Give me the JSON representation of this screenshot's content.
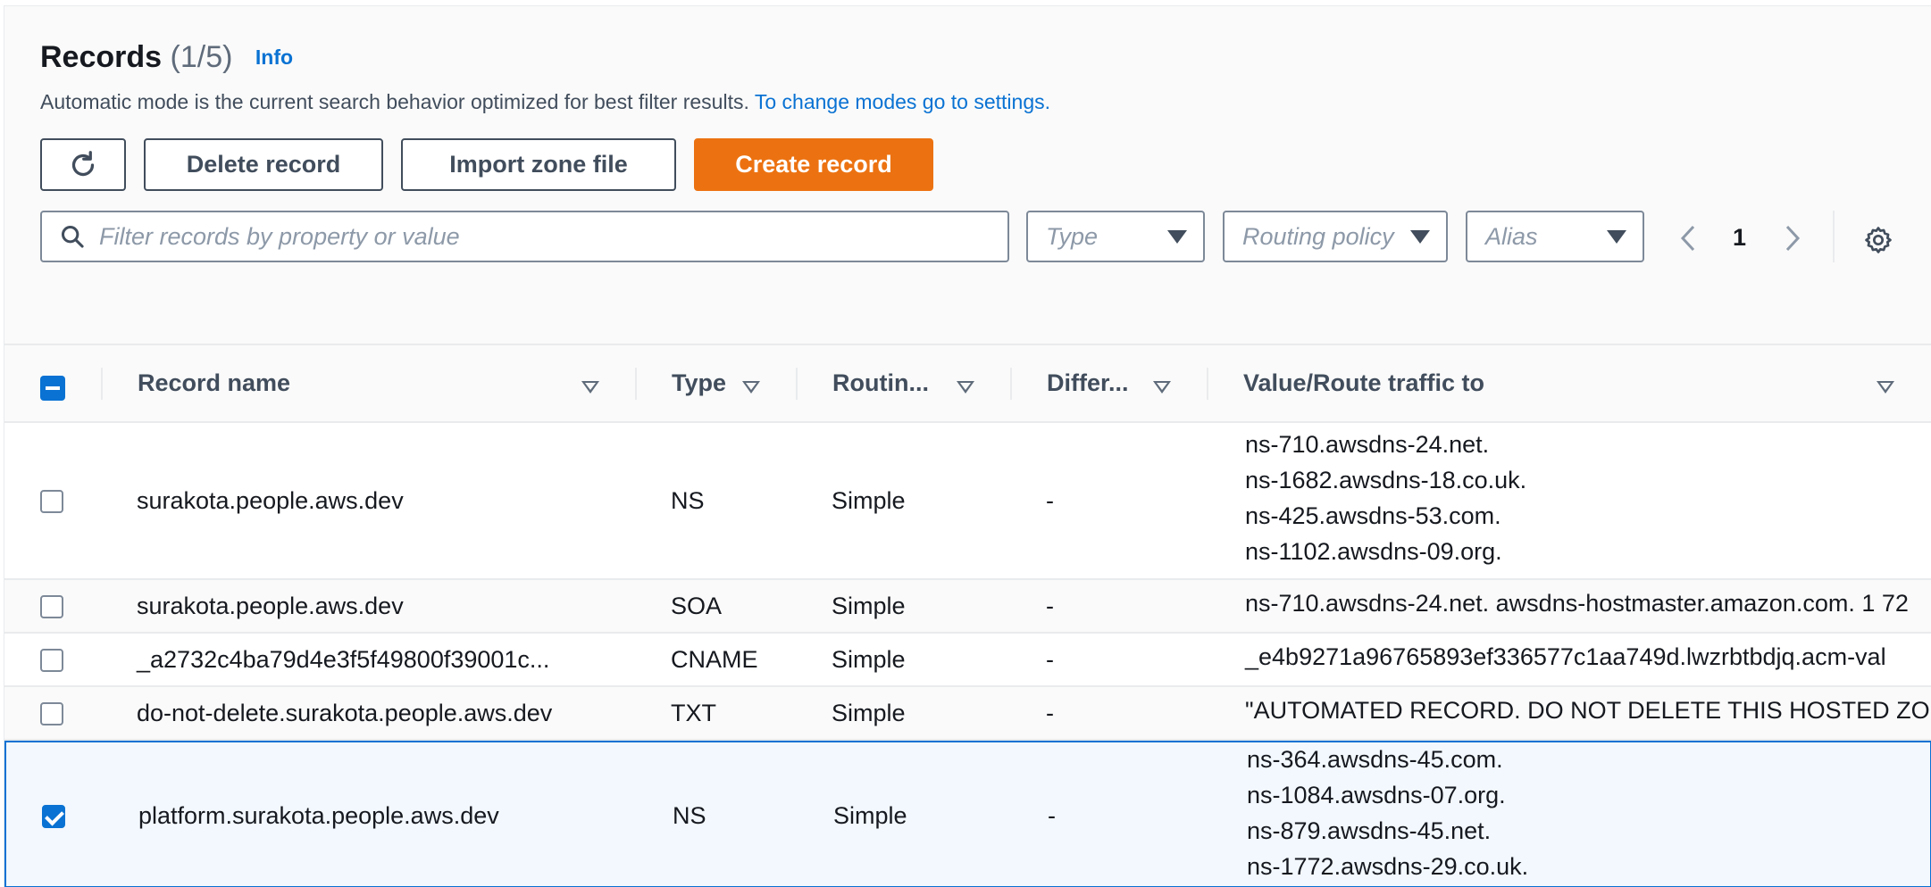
{
  "header": {
    "title": "Records",
    "count": "(1/5)",
    "info_link": "Info",
    "description": "Automatic mode is the current search behavior optimized for best filter results.",
    "description_link": "To change modes go to settings."
  },
  "toolbar": {
    "refresh_icon": "refresh-icon",
    "delete_label": "Delete record",
    "import_label": "Import zone file",
    "create_label": "Create record"
  },
  "filters": {
    "search_placeholder": "Filter records by property or value",
    "type_placeholder": "Type",
    "routing_placeholder": "Routing policy",
    "alias_placeholder": "Alias"
  },
  "pagination": {
    "current_page": "1"
  },
  "colors": {
    "primary": "#ec7211",
    "link": "#0972d3",
    "selected_bg": "#f2f8fd"
  },
  "table": {
    "columns": {
      "record_name": "Record name",
      "type": "Type",
      "routing": "Routin...",
      "differentiator": "Differ...",
      "value": "Value/Route traffic to"
    },
    "rows": [
      {
        "name": "surakota.people.aws.dev",
        "type": "NS",
        "routing": "Simple",
        "diff": "-",
        "values": [
          "ns-710.awsdns-24.net.",
          "ns-1682.awsdns-18.co.uk.",
          "ns-425.awsdns-53.com.",
          "ns-1102.awsdns-09.org."
        ],
        "selected": false
      },
      {
        "name": "surakota.people.aws.dev",
        "type": "SOA",
        "routing": "Simple",
        "diff": "-",
        "values": [
          "ns-710.awsdns-24.net. awsdns-hostmaster.amazon.com. 1 72"
        ],
        "selected": false
      },
      {
        "name": "_a2732c4ba79d4e3f5f49800f39001c...",
        "type": "CNAME",
        "routing": "Simple",
        "diff": "-",
        "values": [
          "_e4b9271a96765893ef336577c1aa749d.lwzrbtbdjq.acm-val"
        ],
        "selected": false
      },
      {
        "name": "do-not-delete.surakota.people.aws.dev",
        "type": "TXT",
        "routing": "Simple",
        "diff": "-",
        "values": [
          "\"AUTOMATED RECORD. DO NOT DELETE THIS HOSTED ZONE"
        ],
        "selected": false
      },
      {
        "name": "platform.surakota.people.aws.dev",
        "type": "NS",
        "routing": "Simple",
        "diff": "-",
        "values": [
          "ns-364.awsdns-45.com.",
          "ns-1084.awsdns-07.org.",
          "ns-879.awsdns-45.net.",
          "ns-1772.awsdns-29.co.uk."
        ],
        "selected": true
      }
    ]
  }
}
